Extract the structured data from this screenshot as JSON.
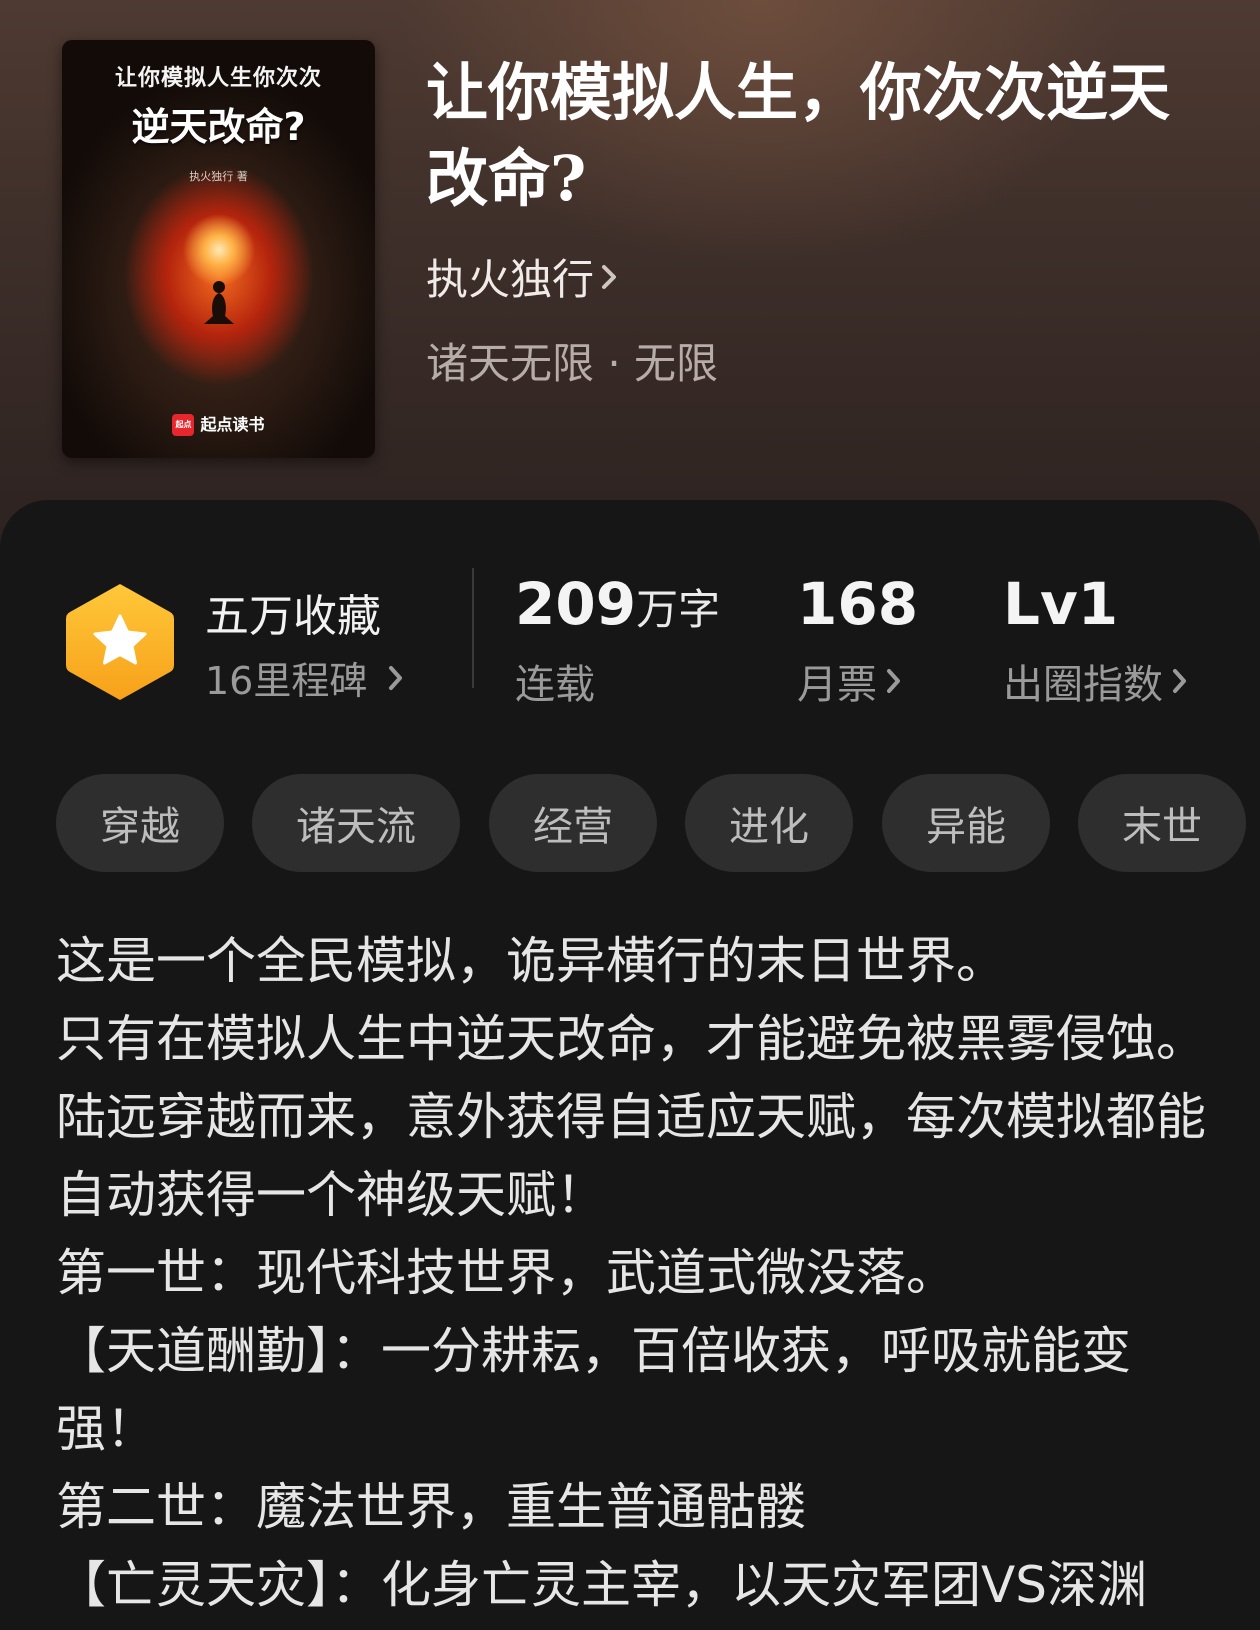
{
  "book": {
    "cover": {
      "title_small": "让你模拟人生你次次",
      "title_big": "逆天改命?",
      "author_small": "执火独行 著",
      "brand_logo": "起点",
      "brand": "起点读书"
    },
    "title": "让你模拟人生，你次次逆天改命?",
    "author": "执火独行",
    "genre": "诸天无限 · 无限"
  },
  "stats": {
    "favorites": "五万收藏",
    "milestones": "16里程碑",
    "word_count_num": "209",
    "word_count_unit": "万字",
    "status": "连载",
    "monthly_votes": "168",
    "monthly_votes_label": "月票",
    "level": "Lv1",
    "level_label": "出圈指数"
  },
  "tags": [
    "穿越",
    "诸天流",
    "经营",
    "进化",
    "异能",
    "末世"
  ],
  "synopsis": [
    "这是一个全民模拟，诡异横行的末日世界。",
    "只有在模拟人生中逆天改命，才能避免被黑雾侵蚀。",
    "陆远穿越而来，意外获得自适应天赋，每次模拟都能自动获得一个神级天赋！",
    "第一世：现代科技世界，武道式微没落。",
    "【天道酬勤】：一分耕耘，百倍收获，呼吸就能变强！",
    "第二世：魔法世界，重生普通骷髅",
    "【亡灵天灾】：化身亡灵主宰，以天灾军团VS深渊"
  ],
  "colors": {
    "badge_top": "#ffc83a",
    "badge_bottom": "#f7a11a",
    "panel_bg": "#161616",
    "tag_bg": "#2e2e2e"
  }
}
